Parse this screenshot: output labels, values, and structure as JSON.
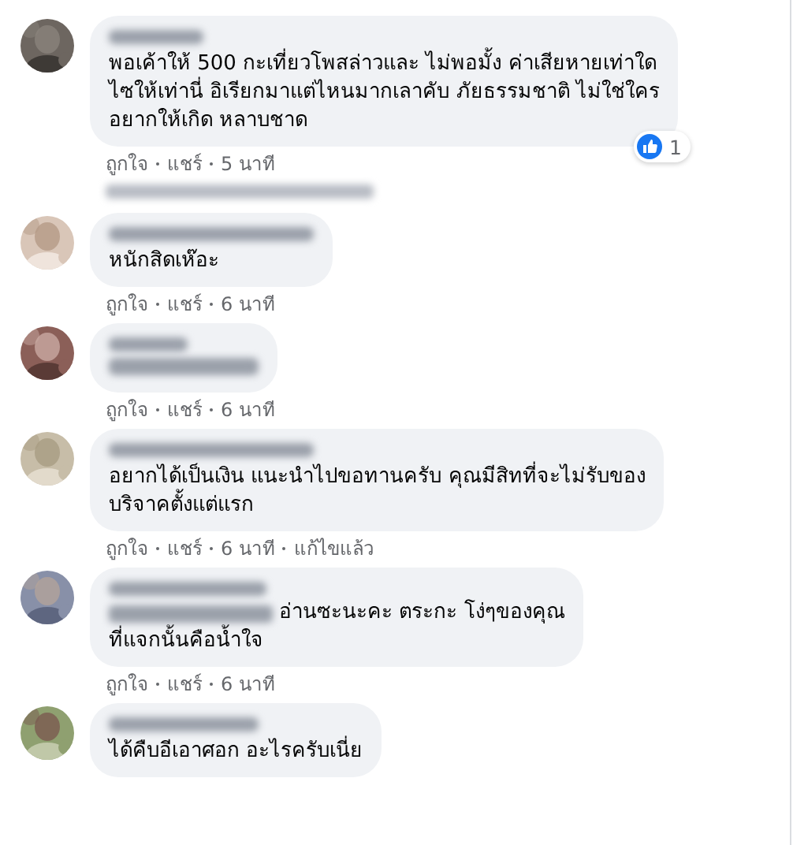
{
  "comments": [
    {
      "avatar": {
        "kind": "picture"
      },
      "text": "พอเค้าให้ 500 กะเที่ยวโพสล่าวและ ไม่พอมั้ง ค่าเสียหายเท่าใด\nไซให้เท่านี่ อิเรียกมาแต่ไหนมากเลาคับ ภัยธรรมชาติ ไม่ใช่ใคร\nอยากให้เกิด หลาบชาด",
      "reaction_count": "1",
      "actions": [
        "ถูกใจ",
        "แชร์",
        "5 นาที"
      ],
      "replies_hidden": true
    },
    {
      "avatar": {
        "kind": "picture"
      },
      "text": "หนักสิดเห๊อะ",
      "actions": [
        "ถูกใจ",
        "แชร์",
        "6 นาที"
      ]
    },
    {
      "avatar": {
        "kind": "picture"
      },
      "text_blurred": true,
      "actions": [
        "ถูกใจ",
        "แชร์",
        "6 นาที"
      ]
    },
    {
      "avatar": {
        "kind": "picture"
      },
      "text": "อยากได้เป็นเงิน แนะนำไปขอทานครับ คุณมีสิทที่จะไม่รับของ\nบริจาคตั้งแต่แรก",
      "actions": [
        "ถูกใจ",
        "แชร์",
        "6 นาที",
        "แก้ไขแล้ว"
      ]
    },
    {
      "avatar": {
        "kind": "picture"
      },
      "text": "อ่านซะนะคะ ตระกะ โง่ๆของคุณ\nที่แจกนั้นคือน้ำใจ",
      "mention_blurred": true,
      "actions": [
        "ถูกใจ",
        "แชร์",
        "6 นาที"
      ]
    },
    {
      "avatar": {
        "kind": "picture"
      },
      "text": "ได้คืบอีเอาศอก อะไรครับเนี่ย"
    }
  ]
}
